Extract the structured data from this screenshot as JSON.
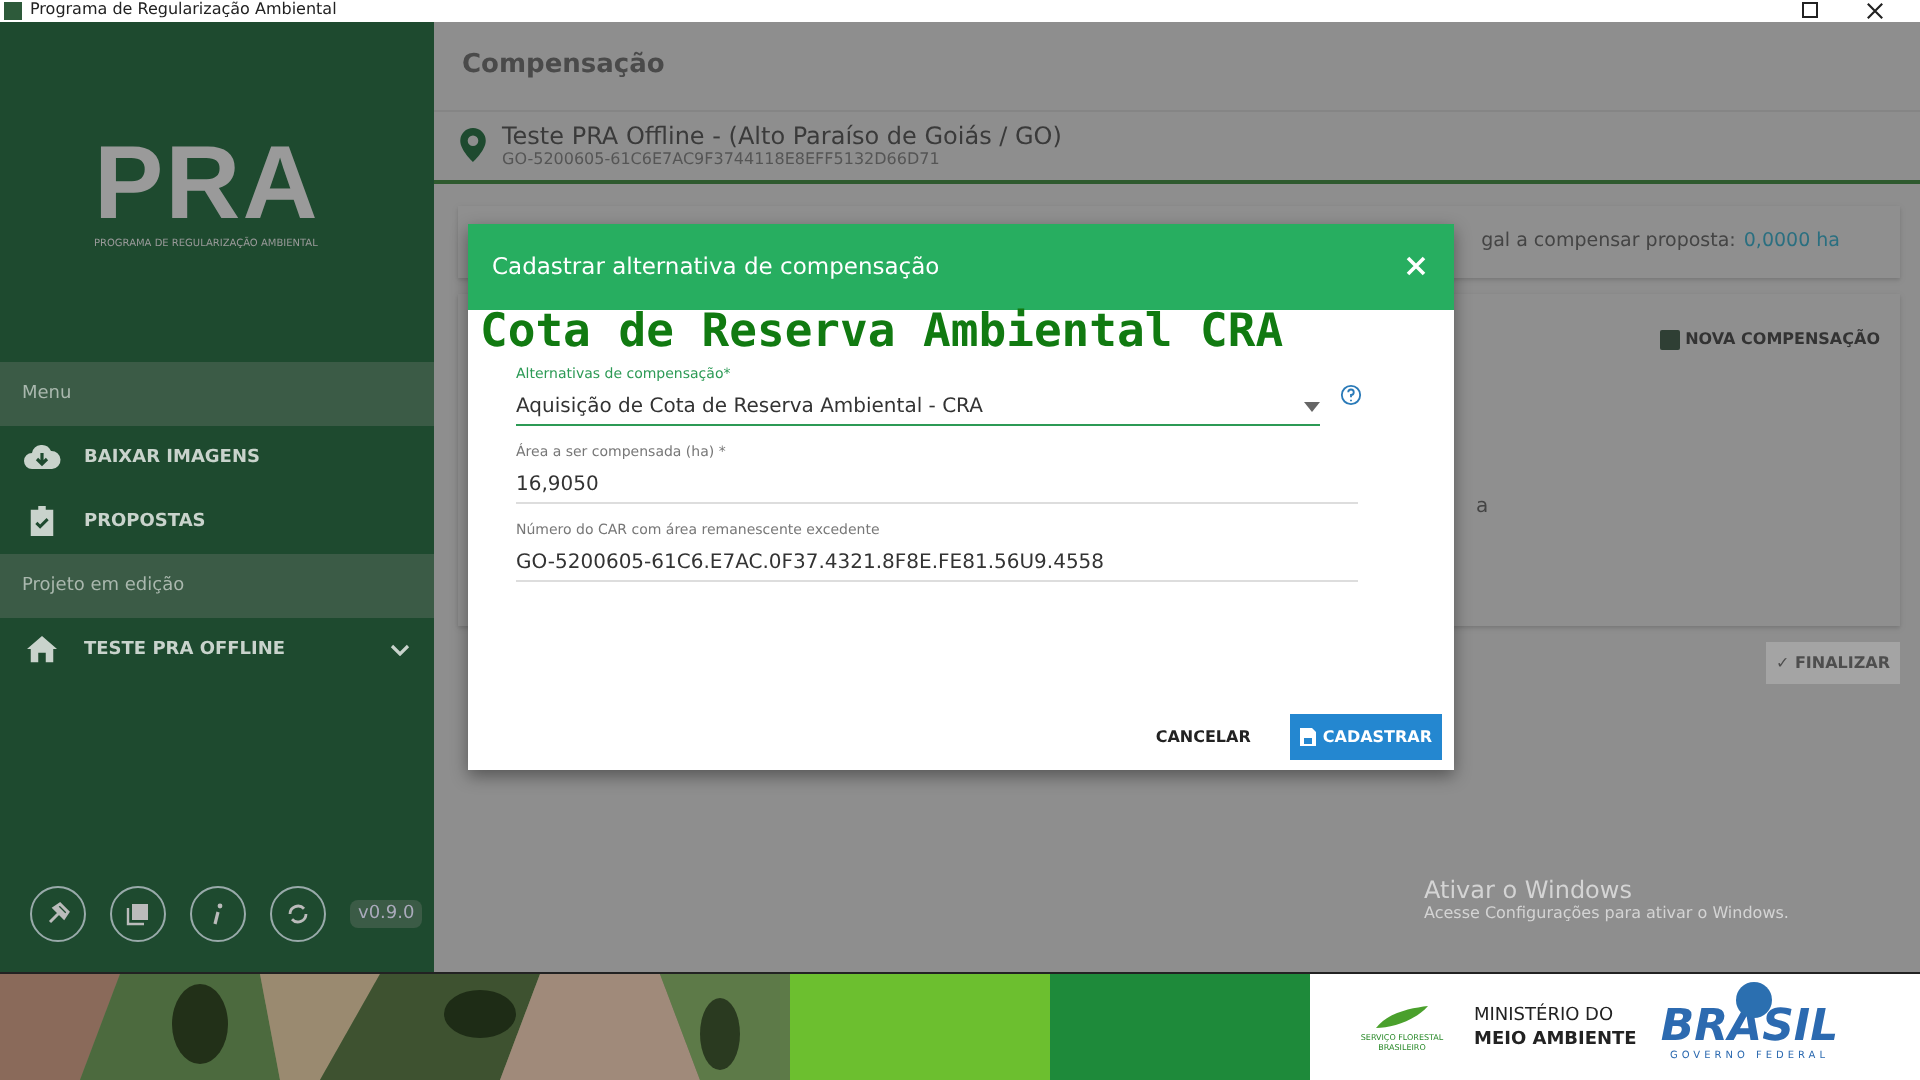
{
  "window": {
    "title": "Programa de Regularização Ambiental"
  },
  "sidebar": {
    "logo": "PRA",
    "logo_subtitle": "PROGRAMA DE REGULARIZAÇÃO AMBIENTAL",
    "sections": [
      {
        "header": "Menu",
        "items": [
          {
            "label": "BAIXAR IMAGENS",
            "expandable": false
          },
          {
            "label": "PROPOSTAS",
            "expandable": false
          }
        ]
      },
      {
        "header": "Projeto em edição",
        "items": [
          {
            "label": "TESTE PRA OFFLINE",
            "expandable": true
          }
        ]
      }
    ],
    "version": "v0.9.0"
  },
  "main": {
    "title": "Compensação",
    "property_name": "Teste PRA Offline - (Alto Paraíso de Goiás / GO)",
    "property_code": "GO-5200605-61C6E7AC9F3744118E8EFF5132D66D71",
    "summary_label": "gal a compensar proposta:",
    "summary_value": "0,0000 ha",
    "new_button": "NOVA COMPENSAÇÃO",
    "card_fragment": "a",
    "finish_button": {
      "label": "✓ FINALIZAR",
      "disabled": true
    }
  },
  "dialog": {
    "title": "Cadastrar alternativa de compensação",
    "fields": [
      {
        "kind": "select",
        "label": "Alternativas de compensação*",
        "value": "Aquisição de Cota de Reserva Ambiental - CRA",
        "help": true
      },
      {
        "kind": "text",
        "label": "Área a ser compensada (ha) *",
        "value": "16,9050"
      },
      {
        "kind": "text",
        "label": "Número do CAR com área remanescente excedente",
        "value": "GO-5200605-61C6.E7AC.0F37.4321.8F8E.FE81.56U9.4558"
      }
    ],
    "cancel": "CANCELAR",
    "submit": "CADASTRAR"
  },
  "caption": "Cota de Reserva Ambiental CRA",
  "activation": {
    "title": "Ativar o Windows",
    "text": "Acesse Configurações para ativar o Windows."
  },
  "banner": {
    "agency": "SERVIÇO FLORESTAL BRASILEIRO",
    "ministry_top": "MINISTÉRIO DO",
    "ministry_bottom": "MEIO AMBIENTE",
    "country": "BRASIL",
    "government": "GOVERNO FEDERAL"
  }
}
